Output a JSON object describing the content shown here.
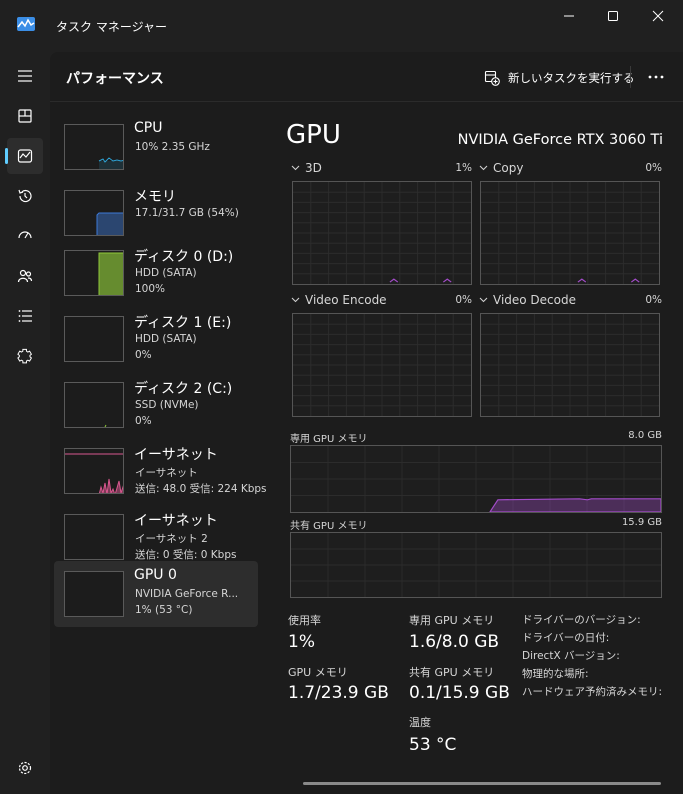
{
  "window": {
    "title": "タスク マネージャー"
  },
  "header": {
    "page_title": "パフォーマンス",
    "run_task_label": "新しいタスクを実行する"
  },
  "nav": {
    "items": [
      "menu-icon",
      "processes-icon",
      "performance-icon",
      "app-history-icon",
      "startup-icon",
      "users-icon",
      "details-icon",
      "services-icon",
      "settings-icon"
    ],
    "active": "performance"
  },
  "devices": [
    {
      "name": "CPU",
      "sub1": "10%  2.35 GHz",
      "sub2": "",
      "sub3": "",
      "color": "#2ea5d8",
      "level": 0.1
    },
    {
      "name": "メモリ",
      "sub1": "17.1/31.7 GB (54%)",
      "sub2": "",
      "sub3": "",
      "color": "#3d79d6",
      "level": 0.54
    },
    {
      "name": "ディスク 0 (D:)",
      "sub1": "HDD (SATA)",
      "sub2": "100%",
      "sub3": "",
      "color": "#8fc93a",
      "level": 1.0
    },
    {
      "name": "ディスク 1 (E:)",
      "sub1": "HDD (SATA)",
      "sub2": "0%",
      "sub3": "",
      "color": "#8fc93a",
      "level": 0
    },
    {
      "name": "ディスク 2 (C:)",
      "sub1": "SSD (NVMe)",
      "sub2": "0%",
      "sub3": "",
      "color": "#8fc93a",
      "level": 0
    },
    {
      "name": "イーサネット",
      "sub1": "イーサネット",
      "sub2": "送信: 48.0  受信: 224 Kbps",
      "sub3": "",
      "color": "#d9578f",
      "level": 0.3
    },
    {
      "name": "イーサネット",
      "sub1": "イーサネット 2",
      "sub2": "送信: 0  受信: 0 Kbps",
      "sub3": "",
      "color": "#d9578f",
      "level": 0
    },
    {
      "name": "GPU 0",
      "sub1": "NVIDIA GeForce R...",
      "sub2": "1%  (53 °C)",
      "sub3": "",
      "color": "#a34cc9",
      "level": 0.01
    }
  ],
  "gpu": {
    "title": "GPU",
    "model": "NVIDIA GeForce RTX 3060 Ti",
    "engines": [
      {
        "label": "3D",
        "pct": "1%"
      },
      {
        "label": "Copy",
        "pct": "0%"
      },
      {
        "label": "Video Encode",
        "pct": "0%"
      },
      {
        "label": "Video Decode",
        "pct": "0%"
      }
    ],
    "dedicated_label": "専用 GPU メモリ",
    "dedicated_max": "8.0 GB",
    "dedicated_level": 0.2,
    "shared_label": "共有 GPU メモリ",
    "shared_max": "15.9 GB",
    "stats": {
      "usage_label": "使用率",
      "usage_value": "1%",
      "ded_label": "専用 GPU メモリ",
      "ded_value": "1.6/8.0 GB",
      "gpumem_label": "GPU メモリ",
      "gpumem_value": "1.7/23.9 GB",
      "shared_label": "共有 GPU メモリ",
      "shared_value": "0.1/15.9 GB",
      "temp_label": "温度",
      "temp_value": "53 °C"
    },
    "info_labels": [
      "ドライバーのバージョン:",
      "ドライバーの日付:",
      "DirectX バージョン:",
      "物理的な場所:",
      "ハードウェア予約済みメモリ:"
    ]
  },
  "colors": {
    "accent": "#60cdff",
    "gpu_line": "#a34cc9"
  }
}
